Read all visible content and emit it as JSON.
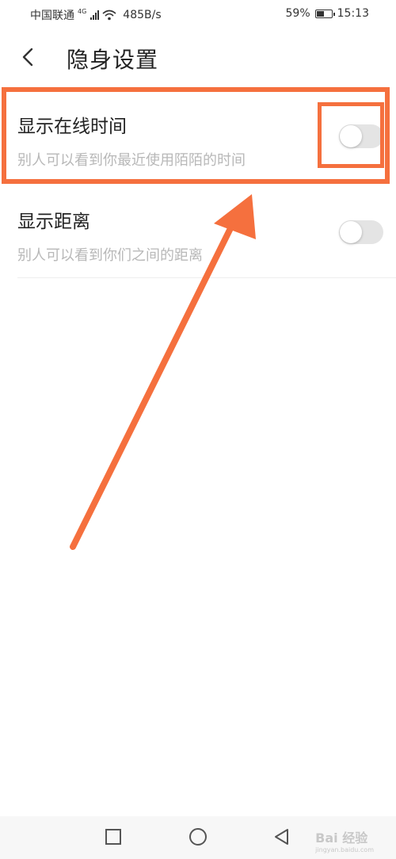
{
  "status_bar": {
    "carrier": "中国联通",
    "network": "4G",
    "speed": "485B/s",
    "battery_percent": "59%",
    "battery_level": 0.59,
    "time": "15:13"
  },
  "header": {
    "title": "隐身设置",
    "back_icon": "chevron-left-icon"
  },
  "settings": [
    {
      "title": "显示在线时间",
      "description": "别人可以看到你最近使用陌陌的时间",
      "enabled": false
    },
    {
      "title": "显示距离",
      "description": "别人可以看到你们之间的距离",
      "enabled": false
    }
  ],
  "annotation": {
    "color": "#f5703e"
  },
  "nav_bar": {
    "buttons": [
      "square-icon",
      "circle-icon",
      "triangle-back-icon"
    ]
  },
  "watermark": {
    "text": "Bai 经验",
    "url": "jingyan.baidu.com"
  }
}
